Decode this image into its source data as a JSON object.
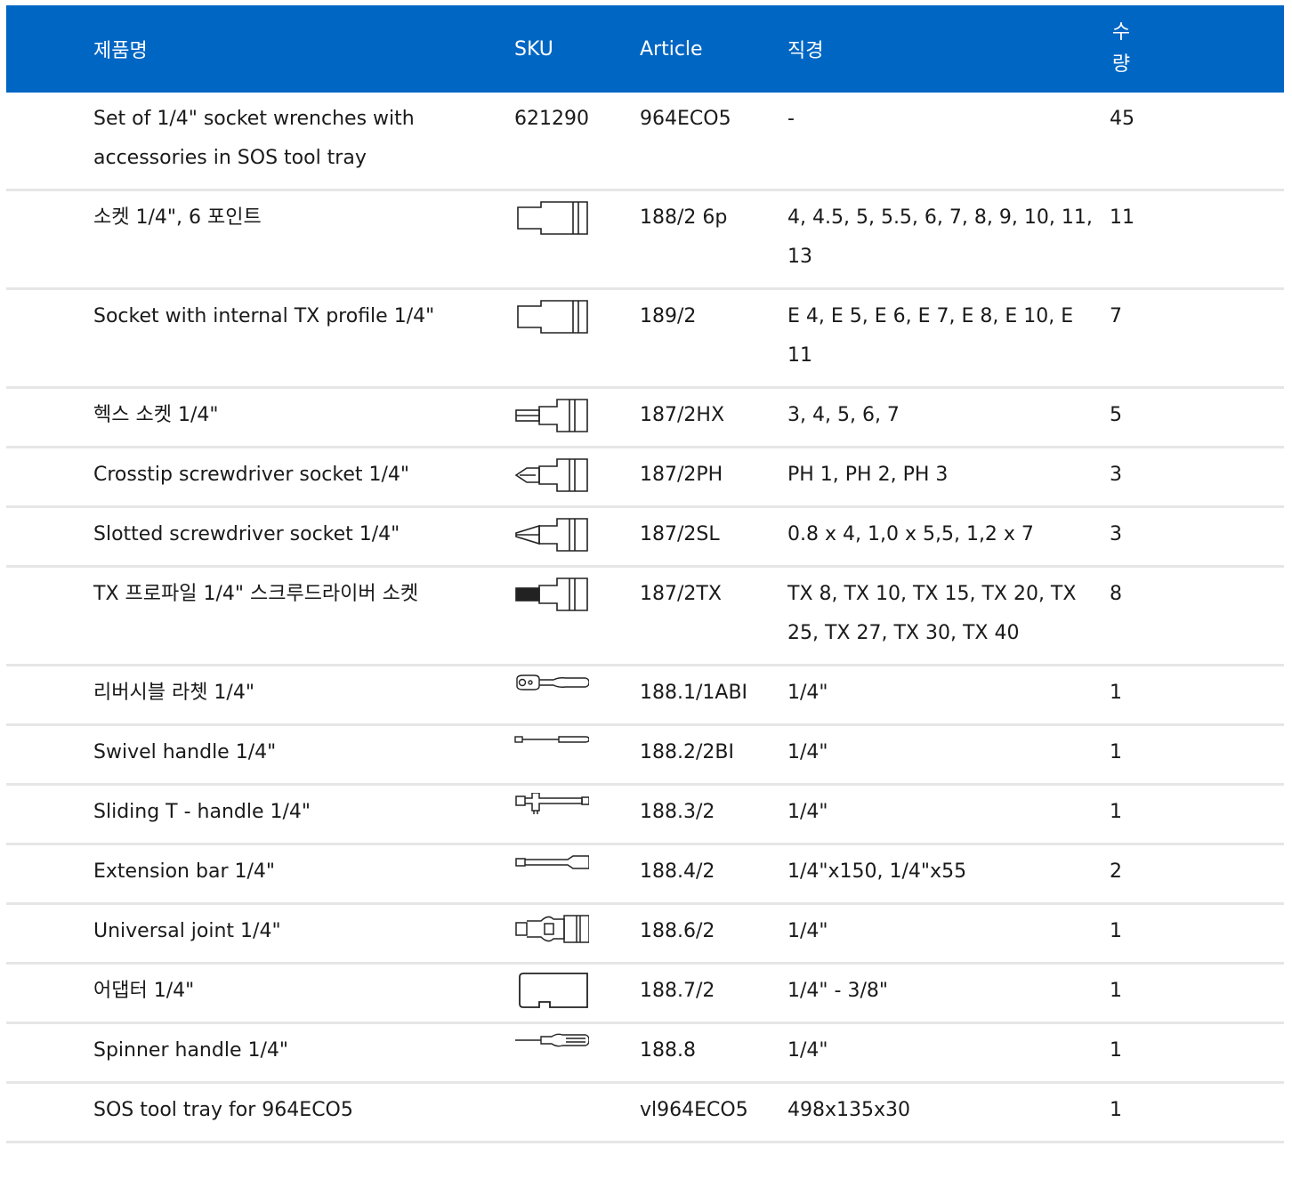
{
  "table": {
    "headers": {
      "name": "제품명",
      "sku": "SKU",
      "article": "Article",
      "diameter": "직경",
      "quantity": "수량"
    },
    "rows": [
      {
        "name": "Set of 1/4\" socket wrenches with accessories in SOS tool tray",
        "sku": "621290",
        "icon": "",
        "article": "964ECO5",
        "diameter": "-",
        "quantity": "45"
      },
      {
        "name": "소켓 1/4\", 6 포인트",
        "sku": "",
        "icon": "socket-icon",
        "article": "188/2 6p",
        "diameter": "4, 4.5, 5, 5.5, 6, 7, 8, 9, 10, 11, 13",
        "quantity": "11"
      },
      {
        "name": "Socket with internal TX profile 1/4\"",
        "sku": "",
        "icon": "socket-icon",
        "article": "189/2",
        "diameter": "E 4, E 5, E 6, E 7, E 8, E 10, E 11",
        "quantity": "7"
      },
      {
        "name": "헥스 소켓 1/4\"",
        "sku": "",
        "icon": "hex-bit-socket-icon",
        "article": "187/2HX",
        "diameter": "3, 4, 5, 6, 7",
        "quantity": "5"
      },
      {
        "name": "Crosstip screwdriver socket 1/4\"",
        "sku": "",
        "icon": "crosstip-bit-socket-icon",
        "article": "187/2PH",
        "diameter": "PH 1, PH 2, PH 3",
        "quantity": "3"
      },
      {
        "name": "Slotted screwdriver socket 1/4\"",
        "sku": "",
        "icon": "slotted-bit-socket-icon",
        "article": "187/2SL",
        "diameter": "0.8 x 4, 1,0 x 5,5, 1,2 x 7",
        "quantity": "3"
      },
      {
        "name": "TX 프로파일 1/4\" 스크루드라이버 소켓",
        "sku": "",
        "icon": "tx-bit-socket-icon",
        "article": "187/2TX",
        "diameter": "TX 8, TX 10, TX 15, TX 20, TX 25, TX 27, TX 30, TX 40",
        "quantity": "8"
      },
      {
        "name": "리버시블 라쳇 1/4\"",
        "sku": "",
        "icon": "ratchet-icon",
        "article": "188.1/1ABI",
        "diameter": "1/4\"",
        "quantity": "1"
      },
      {
        "name": "Swivel handle 1/4\"",
        "sku": "",
        "icon": "swivel-handle-icon",
        "article": "188.2/2BI",
        "diameter": "1/4\"",
        "quantity": "1"
      },
      {
        "name": "Sliding T - handle 1/4\"",
        "sku": "",
        "icon": "t-handle-icon",
        "article": "188.3/2",
        "diameter": "1/4\"",
        "quantity": "1"
      },
      {
        "name": "Extension bar 1/4\"",
        "sku": "",
        "icon": "extension-bar-icon",
        "article": "188.4/2",
        "diameter": "1/4\"x150, 1/4\"x55",
        "quantity": "2"
      },
      {
        "name": "Universal joint 1/4\"",
        "sku": "",
        "icon": "universal-joint-icon",
        "article": "188.6/2",
        "diameter": "1/4\"",
        "quantity": "1"
      },
      {
        "name": "어댑터 1/4\"",
        "sku": "",
        "icon": "adapter-icon",
        "article": "188.7/2",
        "diameter": "1/4\" - 3/8\"",
        "quantity": "1"
      },
      {
        "name": "Spinner handle 1/4\"",
        "sku": "",
        "icon": "spinner-handle-icon",
        "article": "188.8",
        "diameter": "1/4\"",
        "quantity": "1"
      },
      {
        "name": "SOS tool tray for 964ECO5",
        "sku": "",
        "icon": "",
        "article": "vl964ECO5",
        "diameter": "498x135x30",
        "quantity": "1"
      }
    ]
  },
  "colors": {
    "header_bg": "#0066c3",
    "header_text": "#ffffff",
    "row_divider": "#e6e6e6",
    "text": "#1a1a1a"
  }
}
